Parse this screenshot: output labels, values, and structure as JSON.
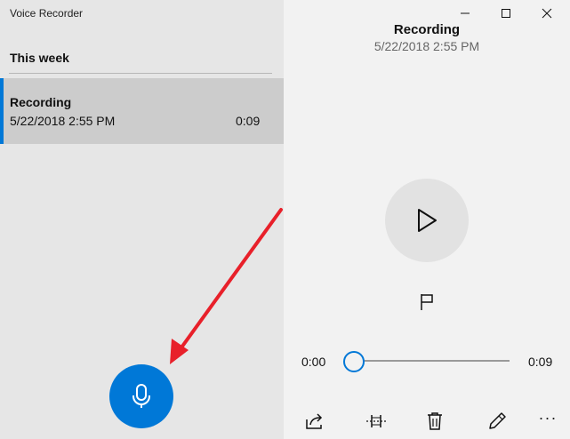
{
  "app": {
    "title": "Voice Recorder"
  },
  "list": {
    "section_header": "This week",
    "items": [
      {
        "name": "Recording",
        "date": "5/22/2018 2:55 PM",
        "duration": "0:09"
      }
    ]
  },
  "detail": {
    "title": "Recording",
    "date": "5/22/2018 2:55 PM",
    "time_start": "0:00",
    "time_end": "0:09",
    "progress": 0
  },
  "icons": {
    "record": "microphone-icon",
    "play": "play-icon",
    "marker": "flag-icon",
    "share": "share-icon",
    "trim": "trim-icon",
    "delete": "trash-icon",
    "rename": "pencil-icon",
    "more": "more-icon"
  },
  "colors": {
    "accent": "#0078d7",
    "annotation_arrow": "#e8202a"
  },
  "toolbar": {
    "more_label": "···"
  }
}
